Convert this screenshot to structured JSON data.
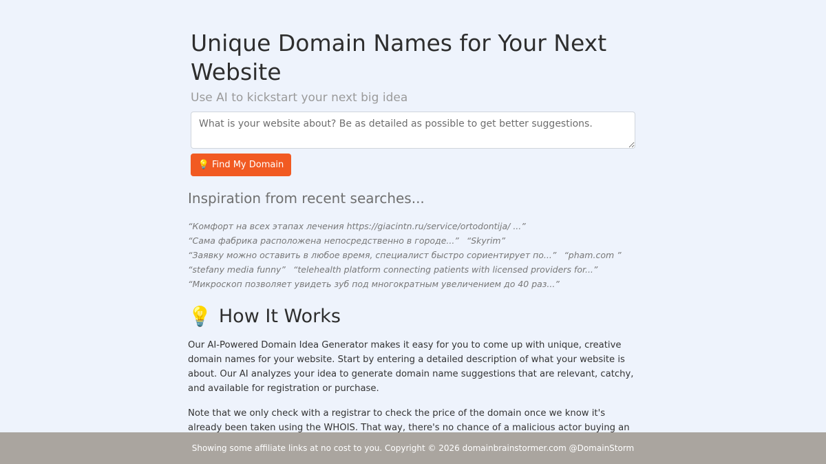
{
  "header": {
    "title": "Unique Domain Names for Your Next Website",
    "subtitle": "Use AI to kickstart your next big idea"
  },
  "search": {
    "placeholder": "What is your website about? Be as detailed as possible to get better suggestions.",
    "button_icon": "💡",
    "button_label": "Find My Domain"
  },
  "inspiration": {
    "heading": "Inspiration from recent searches...",
    "lines": [
      [
        "“Комфорт на всех этапах лечения https://giacintn.ru/service/ortodontija/ ...”"
      ],
      [
        "“Сама фабрика расположена непосредственно в городе...”",
        "“Skyrim”"
      ],
      [
        "“Заявку можно оставить в любое время, специалист быстро сориентирует по...”",
        "“pham.com ”"
      ],
      [
        "“stefany media funny”",
        "“telehealth platform connecting patients with licensed providers for...”"
      ],
      [
        "“Микроскоп позволяет увидеть зуб под многократным увеличением до 40 раз...”"
      ]
    ]
  },
  "how_it_works": {
    "icon": "💡",
    "heading": "How It Works",
    "paragraph1": "Our AI-Powered Domain Idea Generator makes it easy for you to come up with unique, creative domain names for your website. Start by entering a detailed description of what your website is about. Our AI analyzes your idea to generate domain name suggestions that are relevant, catchy, and available for registration or purchase.",
    "paragraph2": "Note that we only check with a registrar to check the price of the domain once we know it's already been taken using the WHOIS. That way, there's no chance of a malicious actor buying an available"
  },
  "footer": {
    "text": "Showing some affiliate links at no cost to you. Copyright © 2026 domainbrainstormer.com @DomainStorm"
  },
  "colors": {
    "background": "#eef3fc",
    "button": "#f15a22",
    "footer": "#aaa59f"
  }
}
